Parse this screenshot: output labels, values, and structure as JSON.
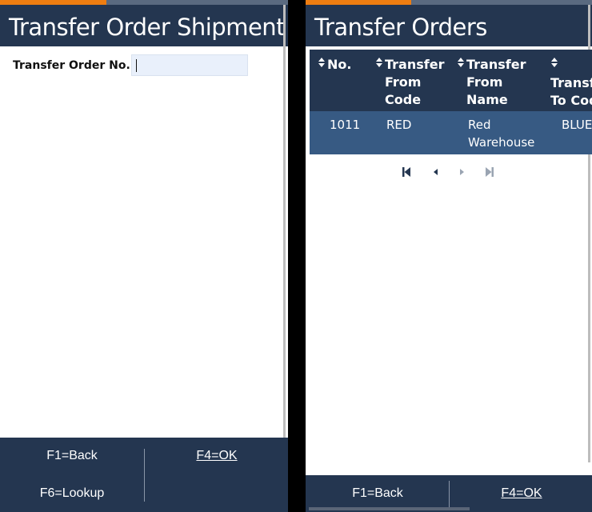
{
  "left_panel": {
    "progress_fraction": 0.37,
    "title": "Transfer Order Shipment",
    "form": {
      "label": "Transfer Order No.",
      "value": "",
      "placeholder": ""
    },
    "footer": {
      "back": "F1=Back",
      "ok": "F4=OK",
      "lookup": "F6=Lookup"
    }
  },
  "right_panel": {
    "progress_fraction": 0.37,
    "title": "Transfer Orders",
    "table": {
      "columns": [
        {
          "label": "No."
        },
        {
          "label": "Transfer\nFrom\nCode"
        },
        {
          "label": "Transfer\nFrom\nName"
        },
        {
          "label": "Transfer\nTo Code"
        }
      ],
      "rows": [
        {
          "no": "1011",
          "from_code": "RED",
          "from_name": "Red\nWarehouse",
          "to_code": "BLUE"
        }
      ]
    },
    "pager": {
      "first": "first-page-icon",
      "prev": "previous-page-icon",
      "next": "next-page-icon",
      "last": "last-page-icon"
    },
    "footer": {
      "back": "F1=Back",
      "ok": "F4=OK"
    }
  },
  "colors": {
    "header_bg": "#243650",
    "accent": "#ee7d11",
    "selected_row": "#375a83",
    "input_bg": "#e9f0fb"
  }
}
